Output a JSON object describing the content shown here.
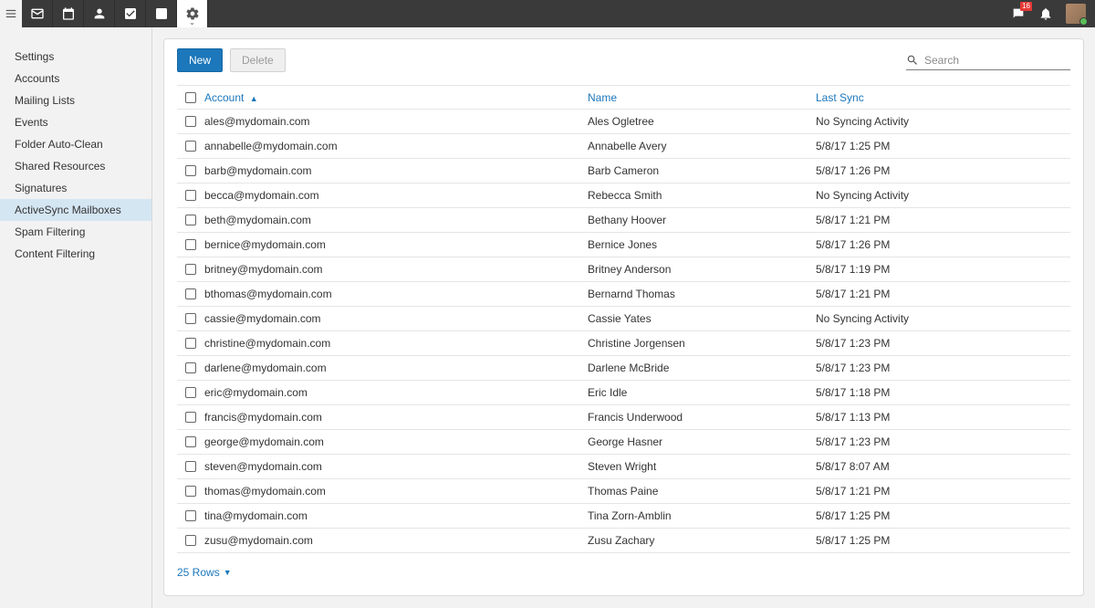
{
  "topbar": {
    "badge_count": "16"
  },
  "sidebar": {
    "items": [
      {
        "label": "Settings"
      },
      {
        "label": "Accounts"
      },
      {
        "label": "Mailing Lists"
      },
      {
        "label": "Events"
      },
      {
        "label": "Folder Auto-Clean"
      },
      {
        "label": "Shared Resources"
      },
      {
        "label": "Signatures"
      },
      {
        "label": "ActiveSync Mailboxes",
        "active": true
      },
      {
        "label": "Spam Filtering"
      },
      {
        "label": "Content Filtering"
      }
    ]
  },
  "toolbar": {
    "new_label": "New",
    "delete_label": "Delete",
    "search_placeholder": "Search"
  },
  "columns": {
    "account": "Account",
    "name": "Name",
    "last_sync": "Last Sync"
  },
  "rows": [
    {
      "account": "ales@mydomain.com",
      "name": "Ales Ogletree",
      "last_sync": "No Syncing Activity"
    },
    {
      "account": "annabelle@mydomain.com",
      "name": "Annabelle Avery",
      "last_sync": "5/8/17 1:25 PM"
    },
    {
      "account": "barb@mydomain.com",
      "name": "Barb Cameron",
      "last_sync": "5/8/17 1:26 PM"
    },
    {
      "account": "becca@mydomain.com",
      "name": "Rebecca Smith",
      "last_sync": "No Syncing Activity"
    },
    {
      "account": "beth@mydomain.com",
      "name": "Bethany Hoover",
      "last_sync": "5/8/17 1:21 PM"
    },
    {
      "account": "bernice@mydomain.com",
      "name": "Bernice Jones",
      "last_sync": "5/8/17 1:26 PM"
    },
    {
      "account": "britney@mydomain.com",
      "name": "Britney Anderson",
      "last_sync": "5/8/17 1:19 PM"
    },
    {
      "account": "bthomas@mydomain.com",
      "name": "Bernarnd Thomas",
      "last_sync": "5/8/17 1:21 PM"
    },
    {
      "account": "cassie@mydomain.com",
      "name": "Cassie Yates",
      "last_sync": "No Syncing Activity"
    },
    {
      "account": "christine@mydomain.com",
      "name": "Christine Jorgensen",
      "last_sync": "5/8/17 1:23 PM"
    },
    {
      "account": "darlene@mydomain.com",
      "name": "Darlene McBride",
      "last_sync": "5/8/17 1:23 PM"
    },
    {
      "account": "eric@mydomain.com",
      "name": "Eric Idle",
      "last_sync": "5/8/17 1:18 PM"
    },
    {
      "account": "francis@mydomain.com",
      "name": "Francis Underwood",
      "last_sync": "5/8/17 1:13 PM"
    },
    {
      "account": "george@mydomain.com",
      "name": "George Hasner",
      "last_sync": "5/8/17 1:23 PM"
    },
    {
      "account": "steven@mydomain.com",
      "name": "Steven Wright",
      "last_sync": "5/8/17 8:07 AM"
    },
    {
      "account": "thomas@mydomain.com",
      "name": "Thomas Paine",
      "last_sync": "5/8/17 1:21 PM"
    },
    {
      "account": "tina@mydomain.com",
      "name": "Tina Zorn-Amblin",
      "last_sync": "5/8/17 1:25 PM"
    },
    {
      "account": "zusu@mydomain.com",
      "name": "Zusu Zachary",
      "last_sync": "5/8/17 1:25 PM"
    }
  ],
  "footer": {
    "rows_label": "25 Rows"
  }
}
